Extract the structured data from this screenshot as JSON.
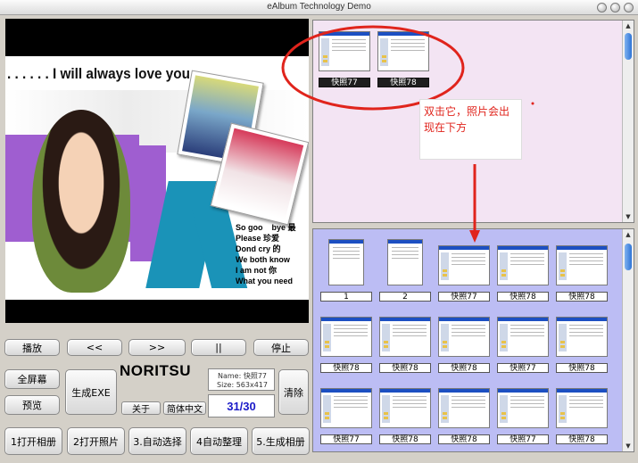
{
  "window": {
    "title": "eAlbum Technology Demo"
  },
  "viewer": {
    "overlay_text": ". . . . . . I will always love you",
    "poem": "So goo    bye 最\nPlease 珍爱\nDond cry 的\nWe both know\nI am not 你\nWhat you need"
  },
  "controls": {
    "play": "播放",
    "prev": "<<",
    "next": ">>",
    "pause": "||",
    "stop": "停止",
    "fullscreen": "全屏幕",
    "preview": "预览",
    "gen_exe": "生成EXE",
    "about": "关于",
    "lang": "简体中文",
    "clear": "清除",
    "open_album": "1打开相册",
    "open_photo": "2打开照片",
    "auto_select": "3.自动选择",
    "auto_arrange": "4自动整理",
    "gen_album": "5.生成相册"
  },
  "brand": "NORITSU",
  "info": {
    "name": "Name: 快照77",
    "size": "Size: 563x417"
  },
  "counter": "31/30",
  "hint": "双击它，照片会出现在下方",
  "colors": {
    "top_pane": "#f3e4f3",
    "bottom_pane": "#bcbdf4",
    "annotation_red": "#e0241c",
    "counter_blue": "#1a1ac8"
  },
  "top_thumbnails": [
    {
      "caption": "快照77"
    },
    {
      "caption": "快照78"
    }
  ],
  "bottom_thumbnails": [
    {
      "caption": "1",
      "portrait": true
    },
    {
      "caption": "2",
      "portrait": true
    },
    {
      "caption": "快照77"
    },
    {
      "caption": "快照78"
    },
    {
      "caption": "快照78"
    },
    {
      "caption": "快照78"
    },
    {
      "caption": "快照78"
    },
    {
      "caption": "快照78"
    },
    {
      "caption": "快照77"
    },
    {
      "caption": "快照78"
    },
    {
      "caption": "快照77"
    },
    {
      "caption": "快照78"
    },
    {
      "caption": "快照78"
    },
    {
      "caption": "快照77"
    },
    {
      "caption": "快照78"
    }
  ]
}
